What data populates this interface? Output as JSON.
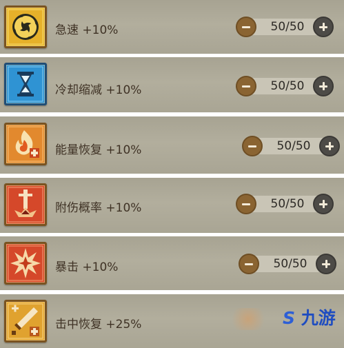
{
  "buffs": [
    {
      "label": "急速 +10%",
      "value": "50/50",
      "icon": "swirl-icon",
      "color": "#e3b22b"
    },
    {
      "label": "冷却缩减 +10%",
      "value": "50/50",
      "icon": "hourglass-icon",
      "color": "#2c8fd1"
    },
    {
      "label": "能量恢复 +10%",
      "value": "50/50",
      "icon": "flame-plus-icon",
      "color": "#e38a2f"
    },
    {
      "label": "附伤概率 +10%",
      "value": "50/50",
      "icon": "sword-impact-icon",
      "color": "#d94b2a"
    },
    {
      "label": "暴击 +10%",
      "value": "50/50",
      "icon": "burst-icon",
      "color": "#d94b2a"
    },
    {
      "label": "击中恢复 +25%",
      "value": "",
      "icon": "sword-plus-icon",
      "color": "#e3a530"
    }
  ],
  "watermark": {
    "text": "九游",
    "logo_glyph": "S"
  }
}
